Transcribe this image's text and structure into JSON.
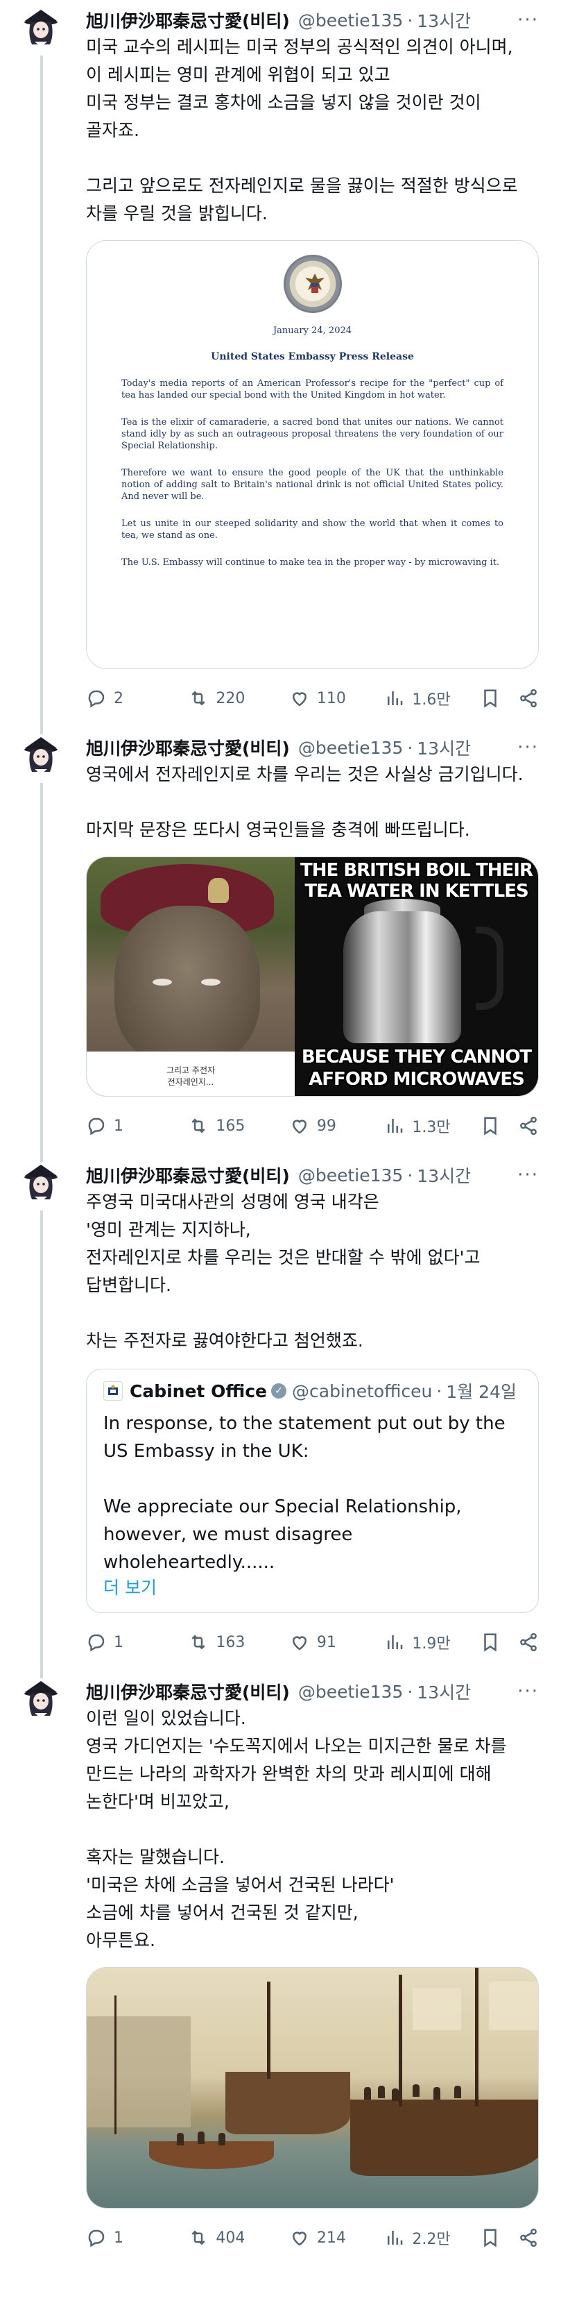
{
  "colors": {
    "text": "#0f1419",
    "muted": "#536471",
    "border": "#cfd9de",
    "link": "#1d9bf0"
  },
  "tweets": [
    {
      "author": "旭川伊沙耶秦忌寸愛(비티)",
      "handle": "@beetie135",
      "time": "13시간",
      "text": "미국 교수의 레시피는 미국 정부의 공식적인 의견이 아니며,\n이 레시피는 영미 관계에 위협이 되고 있고\n미국 정부는 결코 홍차에 소금을 넣지 않을 것이란 것이 골자죠.\n\n그리고 앞으로도 전자레인지로 물을 끓이는 적절한 방식으로 차를 우릴 것을 밝힙니다.",
      "press_release": {
        "seal_text": "UNITED STATES EMBASSY LONDON",
        "date": "January 24, 2024",
        "title": "United States Embassy Press Release",
        "paragraphs": [
          "Today's media reports of an American Professor's recipe for the \"perfect\" cup of tea has landed our special bond with the United Kingdom in hot water.",
          "Tea is the elixir of camaraderie, a sacred bond that unites our nations. We cannot stand idly by as such an outrageous proposal threatens the very foundation of our Special Relationship.",
          "Therefore we want to ensure the good people of the UK that the unthinkable notion of adding salt to Britain's national drink is not official United States policy. And never will be.",
          "Let us unite in our steeped solidarity and show the world that when it comes to tea, we stand as one.",
          "The U.S. Embassy will continue to make tea in the proper way - by microwaving it."
        ]
      },
      "stats": {
        "replies": "2",
        "retweets": "220",
        "likes": "110",
        "views": "1.6만"
      }
    },
    {
      "author": "旭川伊沙耶秦忌寸愛(비티)",
      "handle": "@beetie135",
      "time": "13시간",
      "text": "영국에서 전자레인지로 차를 우리는 것은 사실상 금기입니다.\n\n마지막 문장은 또다시 영국인들을 충격에 빠뜨립니다.",
      "meme": {
        "left_caption_1": "그리고 주전자",
        "left_caption_2": "전자레인지...",
        "top_text": "THE BRITISH BOIL THEIR TEA WATER IN KETTLES",
        "bottom_text": "BECAUSE THEY CANNOT AFFORD MICROWAVES"
      },
      "stats": {
        "replies": "1",
        "retweets": "165",
        "likes": "99",
        "views": "1.3만"
      }
    },
    {
      "author": "旭川伊沙耶秦忌寸愛(비티)",
      "handle": "@beetie135",
      "time": "13시간",
      "text": "주영국 미국대사관의 성명에 영국 내각은\n'영미 관계는 지지하나,\n전자레인지로 차를 우리는 것은 반대할 수 밖에 없다'고 답변합니다.\n\n차는 주전자로 끓여야한다고 첨언했죠.",
      "quote": {
        "name": "Cabinet Office",
        "handle": "@cabinetofficeu",
        "date": "1월 24일",
        "text": "In response, to the statement put out by the US Embassy in the UK:\n\nWe appreciate our Special Relationship, however, we must disagree wholeheartedly......",
        "more": "더 보기"
      },
      "stats": {
        "replies": "1",
        "retweets": "163",
        "likes": "91",
        "views": "1.9만"
      }
    },
    {
      "author": "旭川伊沙耶秦忌寸愛(비티)",
      "handle": "@beetie135",
      "time": "13시간",
      "text": "이런 일이 있었습니다.\n영국 가디언지는 '수도꼭지에서 나오는 미지근한 물로 차를 만드는 나라의 과학자가 완벽한 차의 맛과 레시피에 대해 논한다'며 비꼬았고,\n\n혹자는 말했습니다.\n'미국은 차에 소금을 넣어서 건국된 나라다'\n소금에 차를 넣어서 건국된 것 같지만,\n아무튼요.",
      "stats": {
        "replies": "1",
        "retweets": "404",
        "likes": "214",
        "views": "2.2만"
      }
    }
  ]
}
